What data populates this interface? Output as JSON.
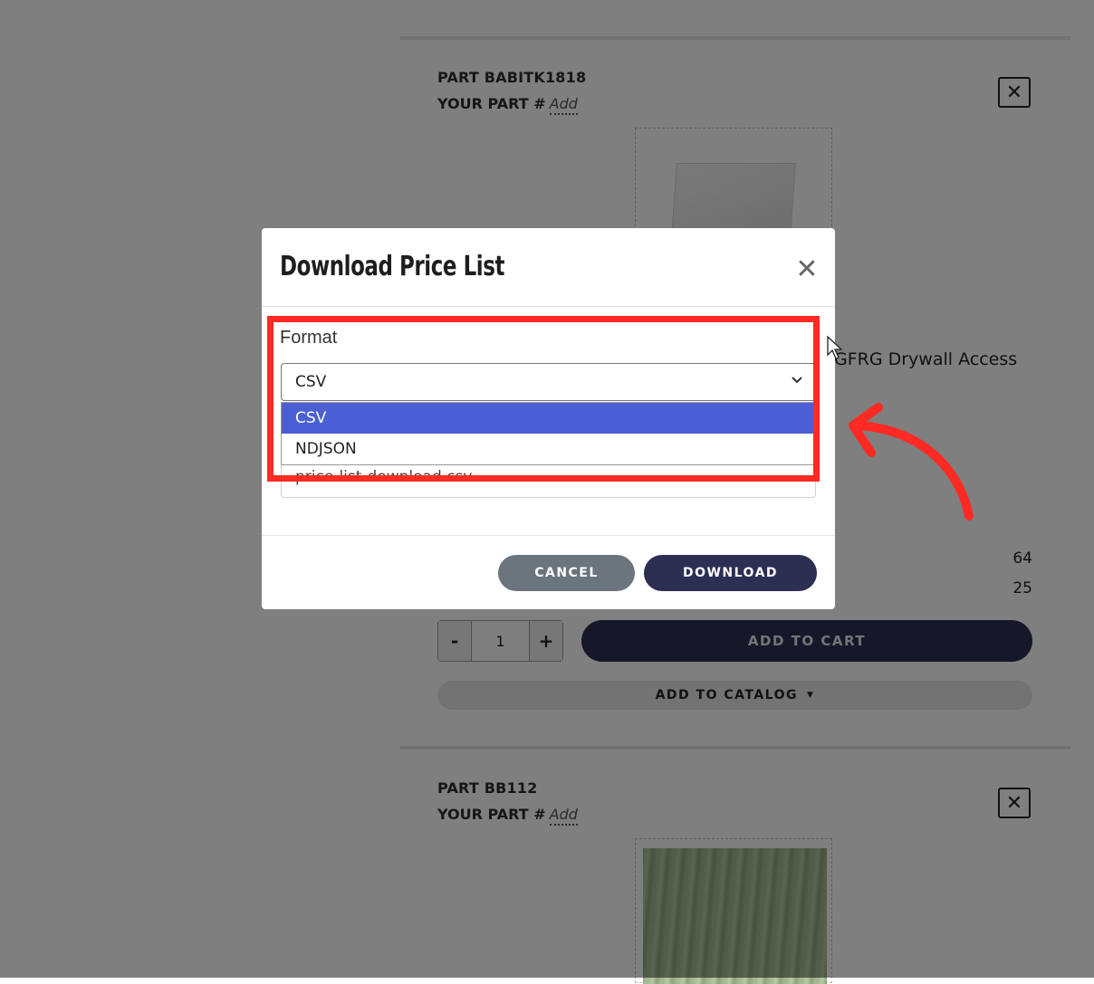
{
  "background": {
    "products": [
      {
        "part_label": "PART BABITK1818",
        "your_part_label": "YOUR PART #",
        "your_part_add": "Add",
        "remove_icon": "close-icon",
        "name_fragment": "GFRG Drywall Access",
        "stock_values": [
          "64",
          "25"
        ],
        "qty_minus": "-",
        "qty_value": "1",
        "qty_plus": "+",
        "add_to_cart": "ADD TO CART",
        "add_to_catalog": "ADD TO CATALOG"
      },
      {
        "part_label": "PART BB112",
        "your_part_label": "YOUR PART #",
        "your_part_add": "Add",
        "remove_icon": "close-icon"
      }
    ]
  },
  "modal": {
    "title": "Download Price List",
    "close_icon": "close-icon",
    "format_label": "Format",
    "format_selected": "CSV",
    "format_options": [
      "CSV",
      "NDJSON"
    ],
    "filename_value": "price-list-download.csv",
    "cancel_label": "CANCEL",
    "download_label": "DOWNLOAD"
  },
  "colors": {
    "overlay": "rgba(0,0,0,0.5)",
    "primary": "#2c2e52",
    "secondary": "#6c757d",
    "option_highlight": "#4a5fd4",
    "annotation": "#ff2a23"
  }
}
